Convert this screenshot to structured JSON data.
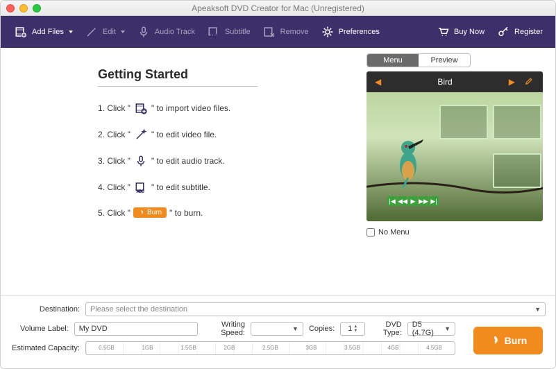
{
  "title": "Apeaksoft DVD Creator for Mac (Unregistered)",
  "toolbar": {
    "add_files": "Add Files",
    "edit": "Edit",
    "audio_track": "Audio Track",
    "subtitle": "Subtitle",
    "remove": "Remove",
    "preferences": "Preferences",
    "buy_now": "Buy Now",
    "register": "Register"
  },
  "getting_started": {
    "heading": "Getting Started",
    "steps": {
      "s1a": "1. Click \"",
      "s1b": "\" to import video files.",
      "s2a": "2. Click \"",
      "s2b": "\" to edit video file.",
      "s3a": "3. Click \"",
      "s3b": "\" to edit audio track.",
      "s4a": "4. Click \"",
      "s4b": "\" to edit subtitle.",
      "s5a": "5. Click \"",
      "s5b": "\" to burn.",
      "burn_pill": "Burn"
    }
  },
  "preview": {
    "tab_menu": "Menu",
    "tab_preview": "Preview",
    "title": "Bird",
    "no_menu": "No Menu"
  },
  "form": {
    "destination_label": "Destination:",
    "destination_placeholder": "Please select the destination",
    "volume_label_label": "Volume Label:",
    "volume_label_value": "My DVD",
    "writing_speed_label": "Writing Speed:",
    "writing_speed_value": "",
    "copies_label": "Copies:",
    "copies_value": "1",
    "dvd_type_label": "DVD Type:",
    "dvd_type_value": "D5 (4.7G)",
    "estimated_capacity_label": "Estimated Capacity:",
    "ticks": [
      "0.5GB",
      "1GB",
      "1.5GB",
      "2GB",
      "2.5GB",
      "3GB",
      "3.5GB",
      "4GB",
      "4.5GB"
    ]
  },
  "burn_button": "Burn"
}
